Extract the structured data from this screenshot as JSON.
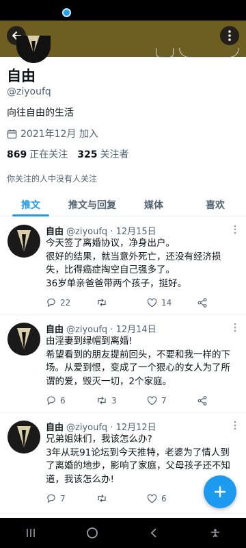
{
  "profile": {
    "name": "自由",
    "handle": "@ziyoufq",
    "bio": "向往自由的生活",
    "joined": "2021年12月 加入",
    "following_count": "869",
    "following_label": "正在关注",
    "followers_count": "325",
    "followers_label": "关注者",
    "note": "你关注的人中没有人关注"
  },
  "tabs": [
    "推文",
    "推文与回复",
    "媒体",
    "喜欢"
  ],
  "tweets": [
    {
      "name": "自由",
      "handle_date": "@ziyoufq · 12月15日",
      "lines": [
        "今天签了离婚协议，净身出户。",
        "很好的结果，就当意外死亡，还没有经济损失，比得癌症掏空自己强多了。",
        "36岁单亲爸爸带两个孩子，挺好。"
      ],
      "replies": "22",
      "retweets": "",
      "likes": "14"
    },
    {
      "name": "自由",
      "handle_date": "@ziyoufq · 12月14日",
      "lines": [
        "由淫妻到绿帽到离婚!",
        "希望看到的朋友提前回头，不要和我一样的下场。从爱到恨，变成了一个狠心的女人为了所谓的爱，毁灭一切，2个家庭。"
      ],
      "replies": "6",
      "retweets": "3",
      "likes": "7"
    },
    {
      "name": "自由",
      "handle_date": "@ziyoufq · 12月12日",
      "lines": [
        "兄弟姐妹们，我该怎么办?",
        "3年从玩91论坛到今天推特，老婆为了情人到了离婚的地步，影响了家庭，父母孩子还不知道，我该怎么办!"
      ],
      "replies": "7",
      "retweets": "",
      "likes": "6"
    }
  ],
  "colors": {
    "accent": "#1d9bf0",
    "banner": "#6f5e22"
  }
}
